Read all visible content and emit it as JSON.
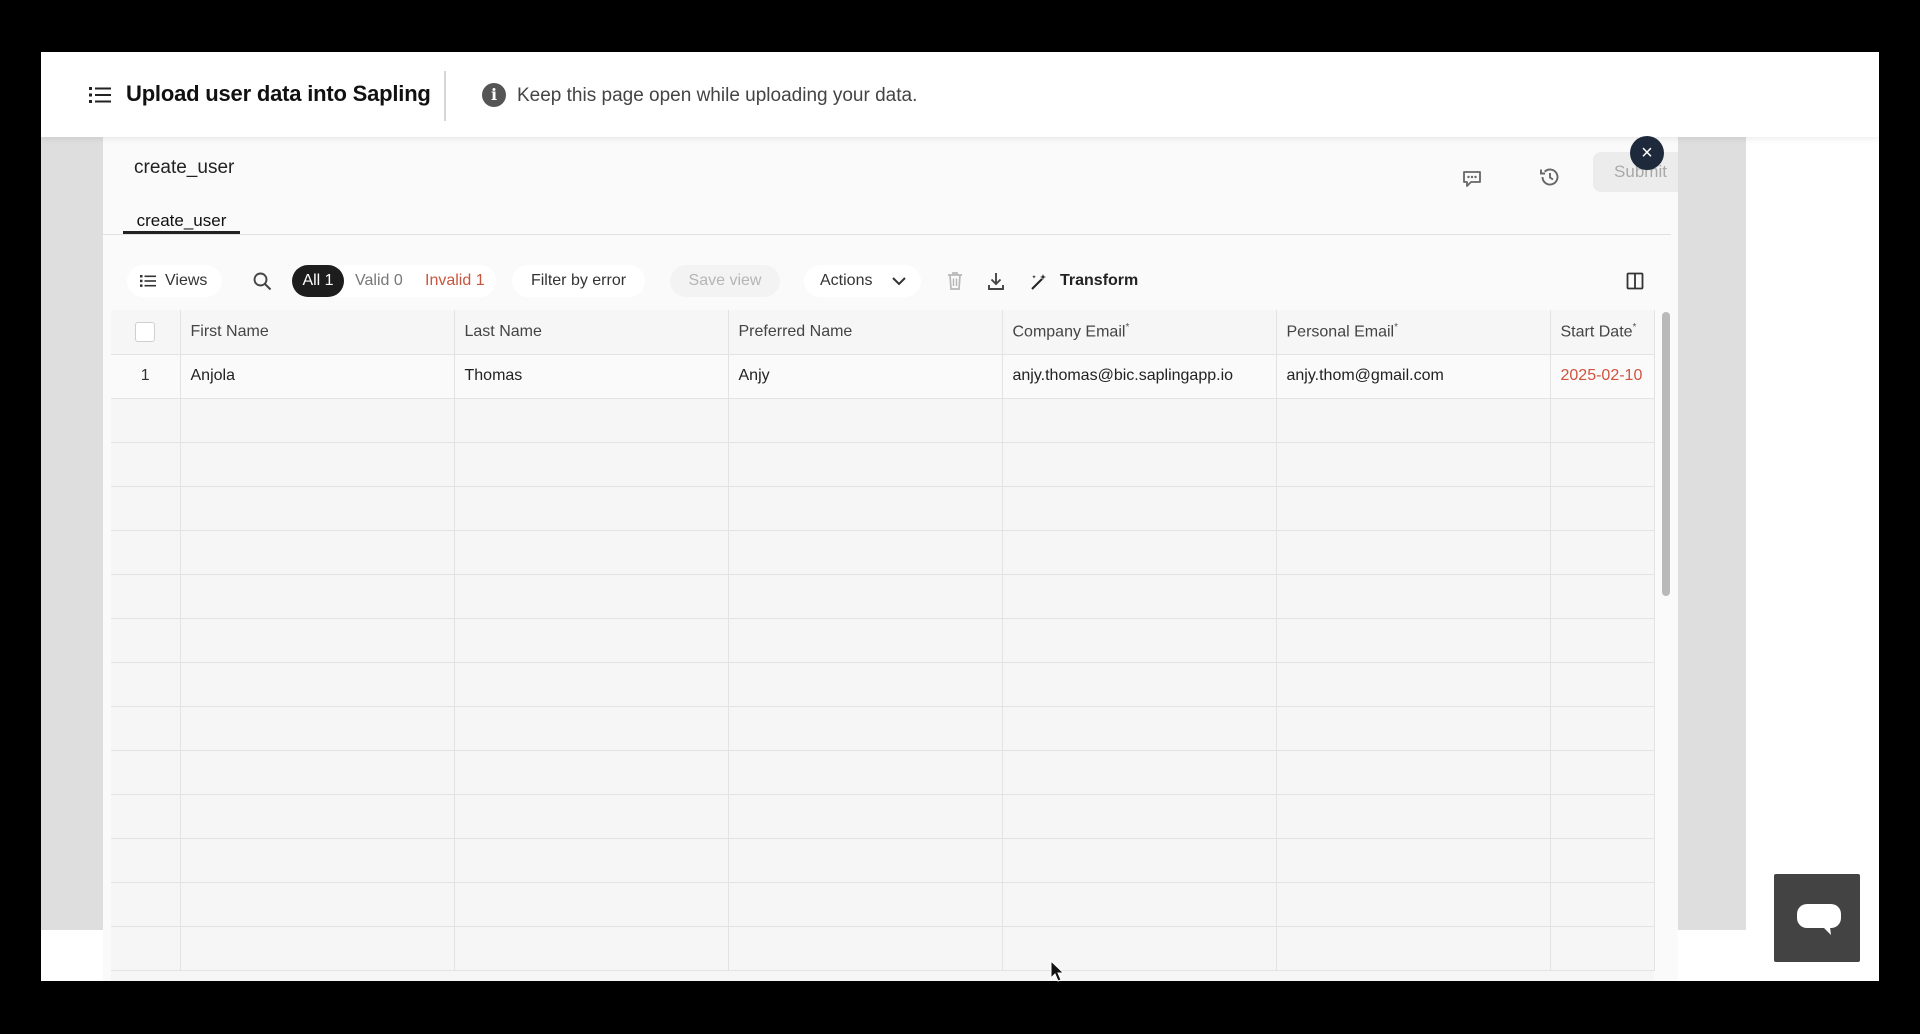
{
  "header": {
    "title": "Upload user data into Sapling",
    "info_text": "Keep this page open while uploading your data."
  },
  "sheet": {
    "title": "create_user",
    "tab_label": "create_user",
    "submit_label": "Submit",
    "close_label": "×"
  },
  "toolbar": {
    "views_label": "Views",
    "filter_all": "All 1",
    "filter_valid": "Valid 0",
    "filter_invalid": "Invalid 1",
    "filter_by_error_label": "Filter by error",
    "save_view_label": "Save view",
    "actions_label": "Actions",
    "transform_label": "Transform"
  },
  "grid": {
    "columns": [
      {
        "label": "First Name",
        "required": false
      },
      {
        "label": "Last Name",
        "required": false
      },
      {
        "label": "Preferred Name",
        "required": false
      },
      {
        "label": "Company Email",
        "required": true
      },
      {
        "label": "Personal Email",
        "required": true
      },
      {
        "label": "Start Date",
        "required": true
      }
    ],
    "required_marker": "*",
    "rows": [
      {
        "num": "1",
        "first_name": "Anjola",
        "last_name": "Thomas",
        "preferred_name": "Anjy",
        "company_email": "anjy.thomas@bic.saplingapp.io",
        "personal_email": "anjy.thom@gmail.com",
        "start_date": "2025-02-10",
        "start_date_invalid": true
      }
    ]
  },
  "icons": {
    "menu": "list-icon",
    "info": "info-icon",
    "comment": "comment-icon",
    "history": "history-icon",
    "search": "search-icon",
    "delete": "trash-icon",
    "download": "download-icon",
    "transform": "magic-wand-icon",
    "columns": "columns-icon",
    "chat": "chat-icon"
  },
  "colors": {
    "invalid": "#d0533e",
    "invalid_bg": "#fbe4e1",
    "active_pill": "#1d1d1d",
    "close_button": "#1e2a3c"
  }
}
